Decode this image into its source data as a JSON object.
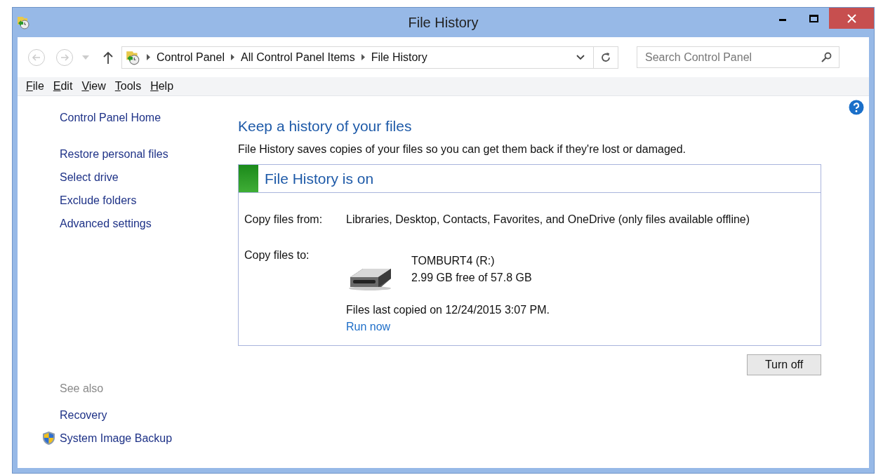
{
  "window": {
    "title": "File History"
  },
  "address_bar": {
    "breadcrumbs": [
      "Control Panel",
      "All Control Panel Items",
      "File History"
    ]
  },
  "search": {
    "placeholder": "Search Control Panel"
  },
  "menu": [
    "File",
    "Edit",
    "View",
    "Tools",
    "Help"
  ],
  "sidebar": {
    "items": [
      "Control Panel Home",
      "Restore personal files",
      "Select drive",
      "Exclude folders",
      "Advanced settings"
    ],
    "see_also_label": "See also",
    "see_also": [
      {
        "label": "Recovery",
        "kind": "link"
      },
      {
        "label": "System Image Backup",
        "kind": "shield"
      }
    ]
  },
  "main": {
    "heading": "Keep a history of your files",
    "description": "File History saves copies of your files so you can get them back if they're lost or damaged.",
    "status": {
      "title": "File History is on",
      "on": true
    },
    "copy_from_label": "Copy files from:",
    "copy_from": "Libraries, Desktop, Contacts, Favorites, and OneDrive (only files available offline)",
    "copy_to_label": "Copy files to:",
    "drive_name": "TOMBURT4 (R:)",
    "drive_space": "2.99 GB free of 57.8 GB",
    "last_copied": "Files last copied on 12/24/2015 3:07 PM.",
    "run_now": "Run now",
    "button": "Turn off"
  }
}
